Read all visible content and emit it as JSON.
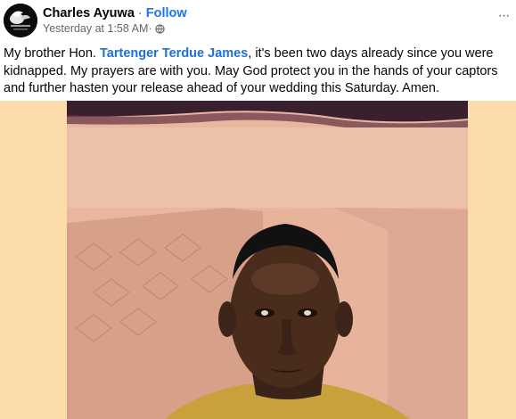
{
  "post": {
    "author": "Charles Ayuwa",
    "separator": " · ",
    "follow_label": "Follow",
    "timestamp": "Yesterday at 1:58 AM",
    "meta_separator": " · ",
    "audience_icon": "globe-icon",
    "more_icon": "more-options-icon",
    "more_glyph": "···",
    "text_before_mention": "My brother Hon. ",
    "mention": "Tartenger Terdue James",
    "text_after_mention": ", it's been two days already since you were kidnapped. My prayers are with you. May God protect you in the hands of your captors and further hasten your release ahead of your wedding this Saturday. Amen."
  },
  "colors": {
    "link": "#1877f2",
    "mention": "#216fdb",
    "secondary_text": "#65676b",
    "media_background": "#fbdcaa"
  }
}
